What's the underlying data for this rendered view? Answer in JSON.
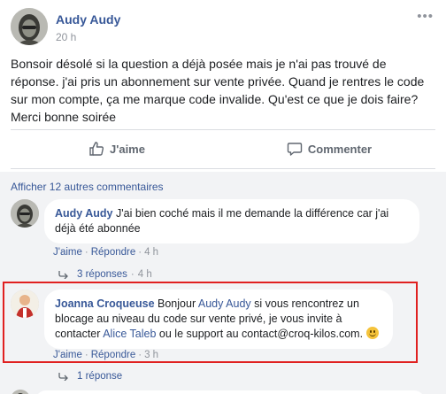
{
  "post": {
    "author": "Audy Audy",
    "time": "20 h",
    "text": "Bonsoir désolé si la question a déjà posée mais je n'ai pas trouvé de réponse. j'ai pris un abonnement sur vente privée. Quand je rentres le code sur mon compte, ça me marque code invalide. Qu'est ce que je dois faire? Merci bonne soirée",
    "more_icon": "ellipsis-icon"
  },
  "actions": {
    "like_label": "J'aime",
    "comment_label": "Commenter"
  },
  "comments": {
    "more_label": "Afficher 12 autres commentaires",
    "items": [
      {
        "author": "Audy Audy",
        "text": "J'ai bien coché mais il me demande la différence car j'ai déjà été abonnée",
        "like": "J'aime",
        "reply": "Répondre",
        "time": "4 h",
        "replies": "3 réponses",
        "replies_time": "4 h"
      },
      {
        "author": "Joanna Croqueuse",
        "text_before": "Bonjour ",
        "mention1": "Audy Audy",
        "text_middle": " si vous rencontrez un blocage au niveau du code sur vente privé, je vous invite à contacter ",
        "mention2": "Alice Taleb",
        "text_after": " ou le support au contact@croq-kilos.com.",
        "like": "J'aime",
        "reply": "Répondre",
        "time": "3 h",
        "replies": "1 réponse"
      }
    ]
  },
  "colors": {
    "link": "#385898",
    "muted": "#90949c",
    "highlight": "#e02020"
  }
}
